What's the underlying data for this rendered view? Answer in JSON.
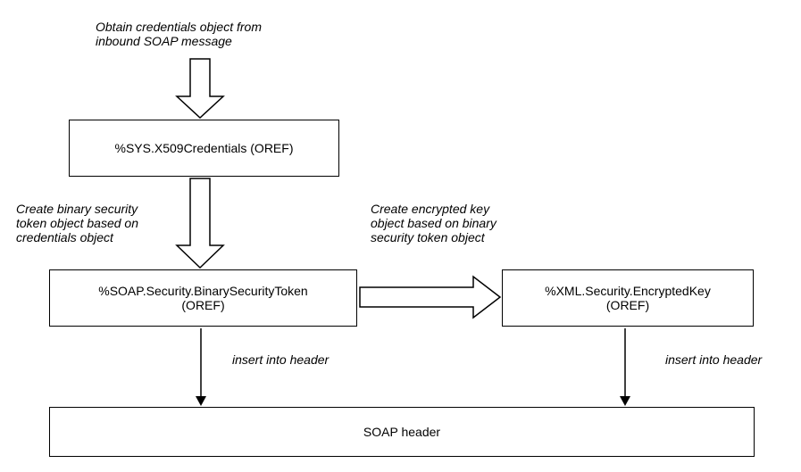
{
  "labels": {
    "top_caption_line1": "Obtain credentials object from",
    "top_caption_line2": "inbound SOAP message",
    "left_caption_line1": "Create binary security",
    "left_caption_line2": "token object based on",
    "left_caption_line3": "credentials object",
    "right_caption_line1": "Create encrypted key",
    "right_caption_line2": "object based on binary",
    "right_caption_line3": "security token object",
    "insert_left": "insert into header",
    "insert_right": "insert into header"
  },
  "boxes": {
    "credentials_line1": "%SYS.X509Credentials (OREF)",
    "bst_line1": "%SOAP.Security.BinarySecurityToken",
    "bst_line2": "(OREF)",
    "enckey_line1": "%XML.Security.EncryptedKey",
    "enckey_line2": "(OREF)",
    "soap_header": "SOAP header"
  }
}
